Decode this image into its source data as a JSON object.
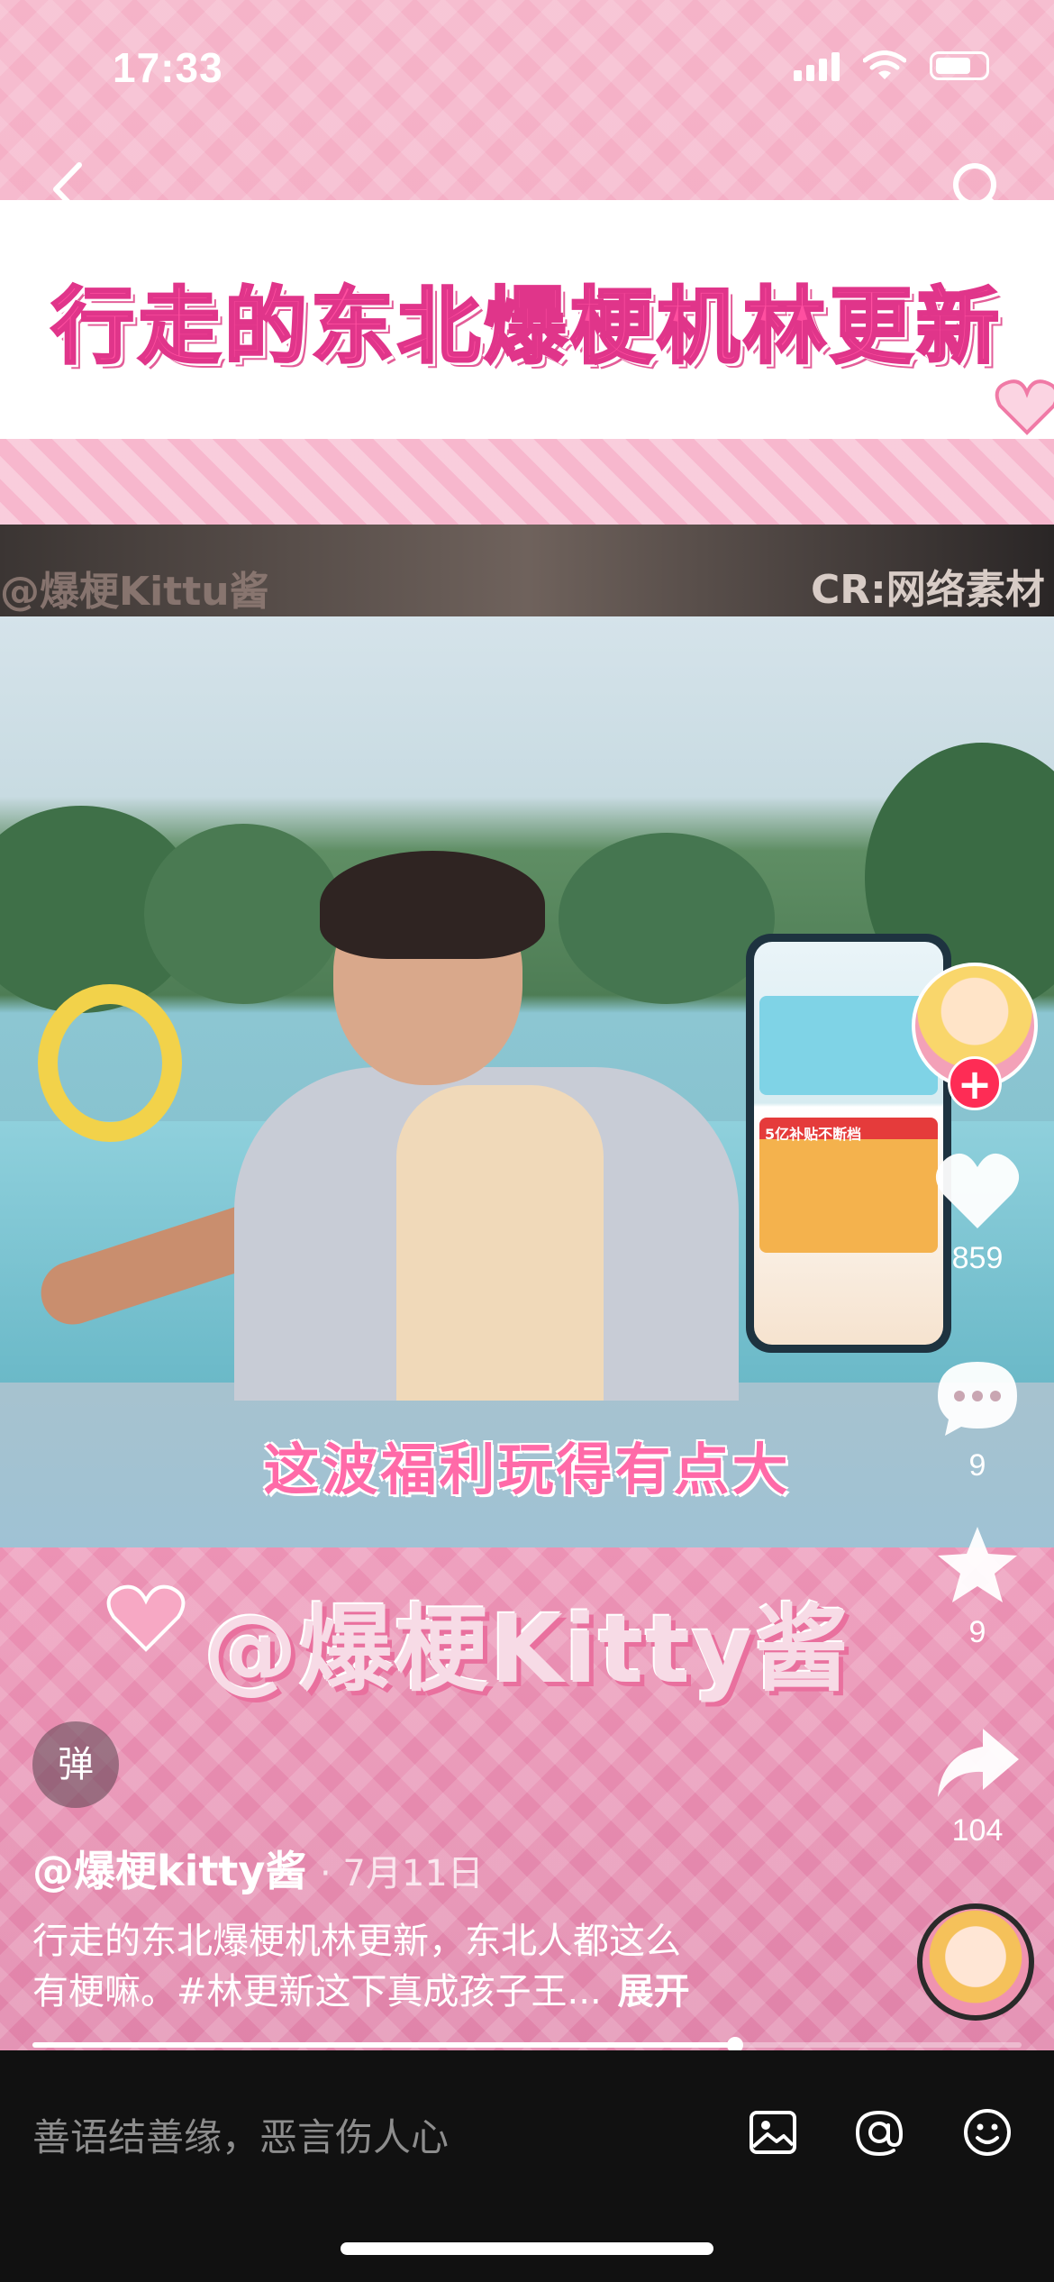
{
  "status_bar": {
    "time": "17:33"
  },
  "banner": {
    "title": "行走的东北爆梗机林更新"
  },
  "video": {
    "watermark_left": "@爆梗Kittu酱",
    "watermark_right": "CR:网络素材",
    "subtitle": "这波福利玩得有点大",
    "handle_overlay": "@爆梗Kitty酱",
    "phone_label": "5亿补贴不断档"
  },
  "actions": {
    "follow": "+",
    "likes": "859",
    "comments": "9",
    "favorites": "9",
    "shares": "104"
  },
  "danmu": {
    "label": "弹"
  },
  "post": {
    "author": "@爆梗kitty酱",
    "date": "· 7月11日",
    "desc_line1": "行走的东北爆梗机林更新，东北人都这么",
    "desc_line2": "有梗嘛。#林更新这下真成孩子王...",
    "expand": "展开"
  },
  "progress": {
    "fraction": 0.71
  },
  "comment_bar": {
    "placeholder": "善语结善缘，恶言伤人心"
  },
  "colors": {
    "accent_pink": "#ff4fa0",
    "follow_red": "#fe2c55"
  }
}
